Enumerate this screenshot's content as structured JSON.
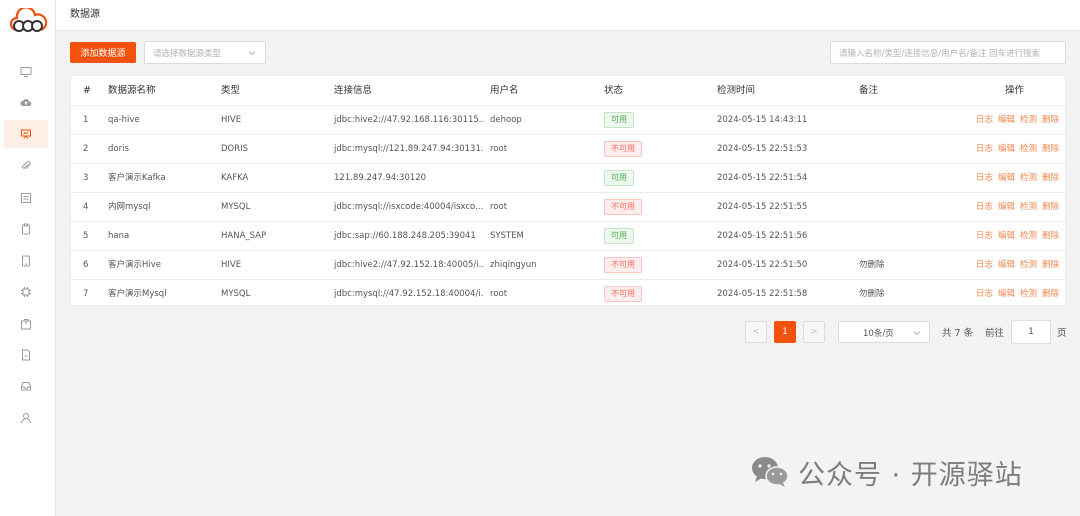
{
  "header": {
    "title": "数据源"
  },
  "toolbar": {
    "add_label": "添加数据源",
    "type_placeholder": "请选择数据源类型",
    "search_placeholder": "请输入名称/类型/连接信息/用户名/备注 回车进行搜索"
  },
  "table": {
    "columns": [
      "#",
      "数据源名称",
      "类型",
      "连接信息",
      "用户名",
      "状态",
      "检测时间",
      "备注",
      "操作"
    ],
    "rows": [
      {
        "idx": "1",
        "name": "qa-hive",
        "type": "HIVE",
        "conn": "jdbc:hive2://47.92.168.116:30115...",
        "user": "dehoop",
        "status": "可用",
        "status_kind": "ok",
        "time": "2024-05-15 14:43:11",
        "note": ""
      },
      {
        "idx": "2",
        "name": "doris",
        "type": "DORIS",
        "conn": "jdbc:mysql://121.89.247.94:30131...",
        "user": "root",
        "status": "不可用",
        "status_kind": "bad",
        "time": "2024-05-15 22:51:53",
        "note": ""
      },
      {
        "idx": "3",
        "name": "客户演示Kafka",
        "type": "KAFKA",
        "conn": "121.89.247.94:30120",
        "user": "",
        "status": "可用",
        "status_kind": "ok",
        "time": "2024-05-15 22:51:54",
        "note": ""
      },
      {
        "idx": "4",
        "name": "内网mysql",
        "type": "MYSQL",
        "conn": "jdbc:mysql://isxcode:40004/isxco...",
        "user": "root",
        "status": "不可用",
        "status_kind": "bad",
        "time": "2024-05-15 22:51:55",
        "note": ""
      },
      {
        "idx": "5",
        "name": "hana",
        "type": "HANA_SAP",
        "conn": "jdbc:sap://60.188.248.205:39041",
        "user": "SYSTEM",
        "status": "可用",
        "status_kind": "ok",
        "time": "2024-05-15 22:51:56",
        "note": ""
      },
      {
        "idx": "6",
        "name": "客户演示Hive",
        "type": "HIVE",
        "conn": "jdbc:hive2://47.92.152.18:40005/i...",
        "user": "zhiqingyun",
        "status": "不可用",
        "status_kind": "bad",
        "time": "2024-05-15 22:51:50",
        "note": "勿删除"
      },
      {
        "idx": "7",
        "name": "客户演示Mysql",
        "type": "MYSQL",
        "conn": "jdbc:mysql://47.92.152.18:40004/i...",
        "user": "root",
        "status": "不可用",
        "status_kind": "bad",
        "time": "2024-05-15 22:51:58",
        "note": "勿删除"
      }
    ],
    "actions": [
      "日志",
      "编辑",
      "检测",
      "删除"
    ]
  },
  "pagination": {
    "prev": "<",
    "current": "1",
    "next": ">",
    "page_size": "10条/页",
    "total": "共 7 条",
    "goto_label": "前往",
    "goto_value": "1",
    "page_unit": "页"
  },
  "sidebar": {
    "items": [
      {
        "icon": "monitor-icon"
      },
      {
        "icon": "cloud-upload-icon"
      },
      {
        "icon": "presentation-icon",
        "active": true
      },
      {
        "icon": "paperclip-icon"
      },
      {
        "icon": "calendar-list-icon"
      },
      {
        "icon": "clipboard-icon"
      },
      {
        "icon": "tablet-icon"
      },
      {
        "icon": "chip-icon"
      },
      {
        "icon": "package-icon"
      },
      {
        "icon": "document-icon"
      },
      {
        "icon": "inbox-icon"
      },
      {
        "icon": "user-icon"
      }
    ]
  },
  "watermark": {
    "text": "公众号 · 开源驿站"
  },
  "colors": {
    "accent": "#f2520d",
    "ok": "#4caf50",
    "bad": "#f36c60",
    "action": "#f2874f"
  }
}
